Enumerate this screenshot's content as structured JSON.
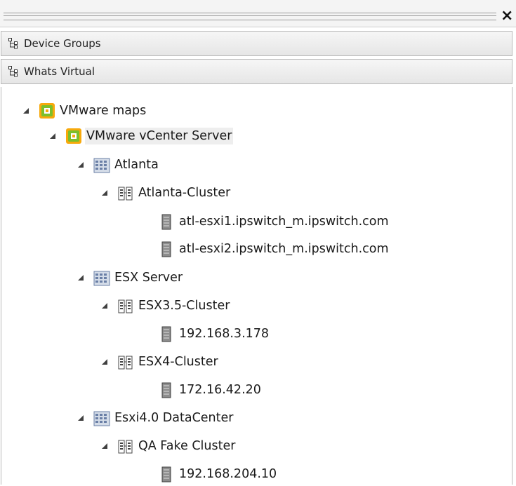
{
  "window": {
    "close_label": "×"
  },
  "tabs": [
    {
      "label": "Device Groups",
      "icon": "tree-structure-icon"
    },
    {
      "label": "Whats Virtual",
      "icon": "tree-structure-icon"
    }
  ],
  "tree": {
    "nodes": [
      {
        "label": "VMware maps",
        "icon": "vmware-icon",
        "expanded": true,
        "depth": 0
      },
      {
        "label": "VMware vCenter Server",
        "icon": "vmware-icon",
        "expanded": true,
        "depth": 1,
        "selected": true
      },
      {
        "label": "Atlanta",
        "icon": "datacenter-icon",
        "expanded": true,
        "depth": 2
      },
      {
        "label": "Atlanta-Cluster",
        "icon": "cluster-icon",
        "expanded": true,
        "depth": 3
      },
      {
        "label": "atl-esxi1.ipswitch_m.ipswitch.com",
        "icon": "server-icon",
        "depth": 4
      },
      {
        "label": "atl-esxi2.ipswitch_m.ipswitch.com",
        "icon": "server-icon",
        "depth": 4
      },
      {
        "label": "ESX Server",
        "icon": "datacenter-icon",
        "expanded": true,
        "depth": 2
      },
      {
        "label": "ESX3.5-Cluster",
        "icon": "cluster-icon",
        "expanded": true,
        "depth": 3
      },
      {
        "label": "192.168.3.178",
        "icon": "server-icon",
        "depth": 4
      },
      {
        "label": "ESX4-Cluster",
        "icon": "cluster-icon",
        "expanded": true,
        "depth": 3
      },
      {
        "label": "172.16.42.20",
        "icon": "server-icon",
        "depth": 4
      },
      {
        "label": "Esxi4.0 DataCenter",
        "icon": "datacenter-icon",
        "expanded": true,
        "depth": 2
      },
      {
        "label": "QA Fake Cluster",
        "icon": "cluster-icon",
        "expanded": true,
        "depth": 3
      },
      {
        "label": "192.168.204.10",
        "icon": "server-icon",
        "depth": 4
      }
    ]
  }
}
